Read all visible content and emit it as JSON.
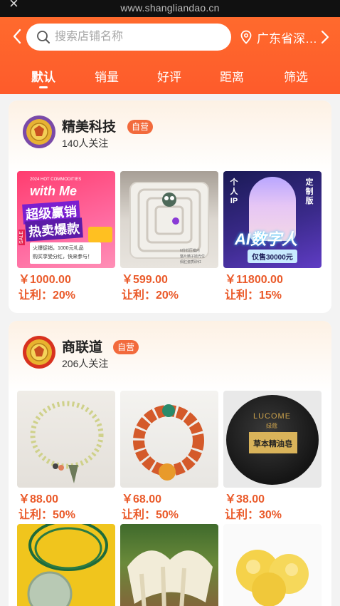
{
  "browser": {
    "url": "www.shangliandao.cn",
    "close_glyph": "×"
  },
  "header": {
    "search_placeholder": "搜索店铺名称",
    "location": "广东省深…"
  },
  "tabs": [
    {
      "label": "默认",
      "active": true
    },
    {
      "label": "销量",
      "active": false
    },
    {
      "label": "好评",
      "active": false
    },
    {
      "label": "距离",
      "active": false
    },
    {
      "label": "筛选",
      "active": false
    }
  ],
  "shops": [
    {
      "name": "精美科技",
      "badge": "自营",
      "followers": "140人关注",
      "products": [
        {
          "price": "￥1000.00",
          "profit": "让利：20%",
          "image_text": {
            "top": "2024 HOT COMMODITIES",
            "logo": "with Me",
            "line1": "超级赢销",
            "line2": "热卖爆款",
            "sale": "SALE",
            "desc1": "火爆促销，1000元礼品",
            "desc2": "购买享受分红，快来参与！"
          }
        },
        {
          "price": "￥599.00",
          "profit": "让利：20%",
          "image_text": {
            "note1": "6份低压模内",
            "note2": "整片精子抛光位",
            "note3": "佩肛瓷质砂红"
          }
        },
        {
          "price": "￥11800.00",
          "profit": "让利：15%",
          "image_text": {
            "left": "个人IP",
            "right": "定制版",
            "title": "AI数字人",
            "tag": "仅售30000元"
          }
        }
      ]
    },
    {
      "name": "商联道",
      "badge": "自营",
      "followers": "206人关注",
      "products": [
        {
          "price": "￥88.00",
          "profit": "让利：50%"
        },
        {
          "price": "￥68.00",
          "profit": "让利：50%"
        },
        {
          "price": "￥38.00",
          "profit": "让利：30%",
          "image_text": {
            "brand": "LUCOME",
            "brand_sub": "绿蔻",
            "label": "草本精油皂"
          }
        },
        {
          "price": "",
          "profit": ""
        },
        {
          "price": "",
          "profit": ""
        },
        {
          "price": "",
          "profit": ""
        }
      ]
    }
  ]
}
